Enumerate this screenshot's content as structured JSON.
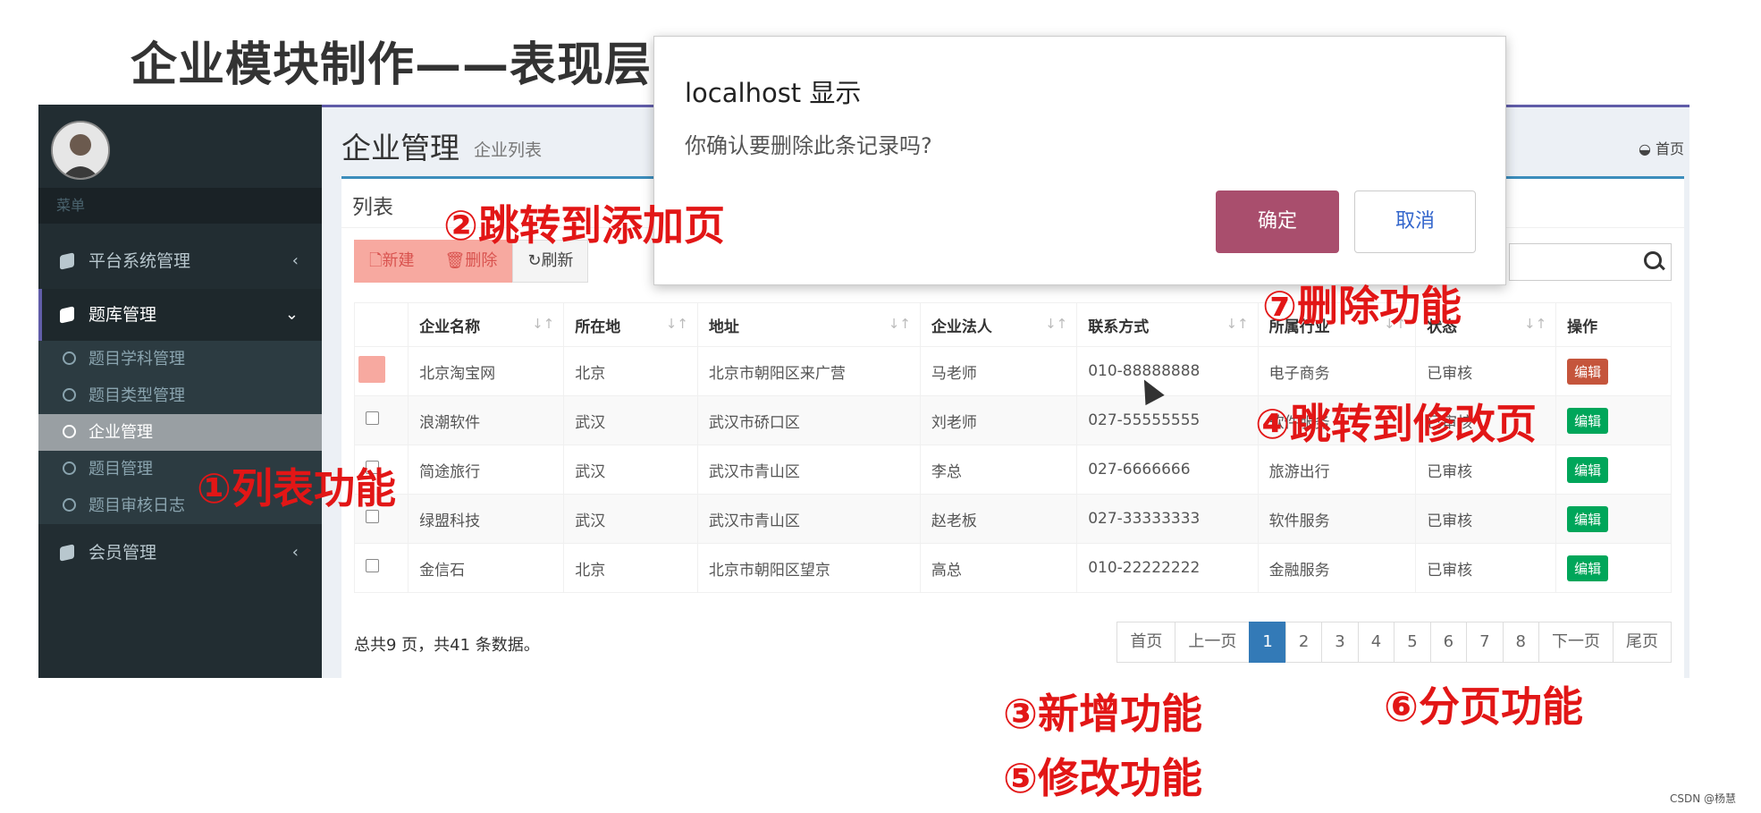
{
  "slide": {
    "title": "企业模块制作——表现层",
    "watermark": "CSDN @杨慧"
  },
  "sidebar": {
    "menu_header": "菜单",
    "items": [
      {
        "label": "平台系统管理",
        "arrow": "‹"
      },
      {
        "label": "题库管理",
        "arrow": "⌄"
      },
      {
        "label": "会员管理",
        "arrow": "‹"
      }
    ],
    "subitems": [
      "题目学科管理",
      "题目类型管理",
      "企业管理",
      "题目管理",
      "题目审核日志"
    ],
    "selected_subitem": "企业管理"
  },
  "header": {
    "title": "企业管理",
    "subtitle": "企业列表",
    "breadcrumb": "首页"
  },
  "box": {
    "title": "列表",
    "toolbar": {
      "new": "新建",
      "delete": "删除",
      "refresh": "刷新"
    }
  },
  "table": {
    "columns": [
      "企业名称",
      "所在地",
      "地址",
      "企业法人",
      "联系方式",
      "所属行业",
      "状态",
      "操作"
    ],
    "edit_label": "编辑",
    "rows": [
      [
        "北京淘宝网",
        "北京",
        "北京市朝阳区来广营",
        "马老师",
        "010-88888888",
        "电子商务",
        "已审核"
      ],
      [
        "浪潮软件",
        "武汉",
        "武汉市硚口区",
        "刘老师",
        "027-55555555",
        "软件服务",
        "已审核"
      ],
      [
        "简途旅行",
        "武汉",
        "武汉市青山区",
        "李总",
        "027-6666666",
        "旅游出行",
        "已审核"
      ],
      [
        "绿盟科技",
        "武汉",
        "武汉市青山区",
        "赵老板",
        "027-33333333",
        "软件服务",
        "已审核"
      ],
      [
        "金信石",
        "北京",
        "北京市朝阳区望京",
        "高总",
        "010-22222222",
        "金融服务",
        "已审核"
      ]
    ]
  },
  "pagination": {
    "summary": "总共9 页，共41 条数据。",
    "first": "首页",
    "prev": "上一页",
    "pages": [
      "1",
      "2",
      "3",
      "4",
      "5",
      "6",
      "7",
      "8"
    ],
    "active": "1",
    "next": "下一页",
    "last": "尾页"
  },
  "dialog": {
    "title": "localhost 显示",
    "message": "你确认要删除此条记录吗?",
    "ok": "确定",
    "cancel": "取消"
  },
  "annotations": {
    "a1": "①列表功能",
    "a2": "②跳转到添加页",
    "a3": "③新增功能",
    "a4": "④跳转到修改页",
    "a5": "⑤修改功能",
    "a6": "⑥分页功能",
    "a7": "⑦删除功能"
  },
  "colors": {
    "sidebar_bg": "#222d32",
    "accent": "#605ca8",
    "box_border": "#3c8dbc",
    "annotation_red": "#e21616",
    "edit_green": "#00a65a"
  }
}
